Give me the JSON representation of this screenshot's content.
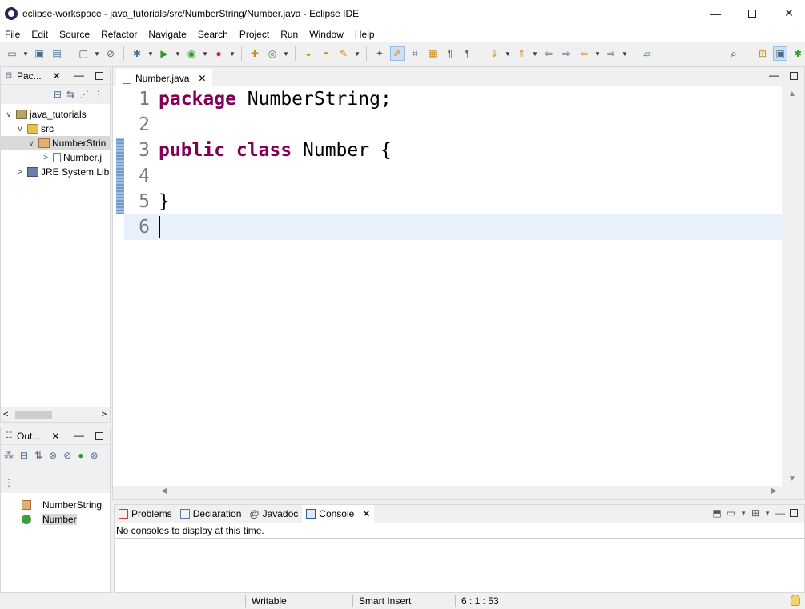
{
  "window": {
    "title": "eclipse-workspace - java_tutorials/src/NumberString/Number.java - Eclipse IDE",
    "minimize_glyph": "—",
    "close_glyph": "✕"
  },
  "menu": [
    "File",
    "Edit",
    "Source",
    "Refactor",
    "Navigate",
    "Search",
    "Project",
    "Run",
    "Window",
    "Help"
  ],
  "package_explorer": {
    "tab_label": "Pac...",
    "tree": [
      {
        "label": "java_tutorials",
        "arrow": "v",
        "icon": "project-icon"
      },
      {
        "label": "src",
        "arrow": "v",
        "icon": "source-folder-icon"
      },
      {
        "label": "NumberStrin",
        "arrow": "v",
        "icon": "package-icon"
      },
      {
        "label": "Number.j",
        "arrow": ">",
        "icon": "java-file-icon"
      },
      {
        "label": "JRE System Lib",
        "arrow": ">",
        "icon": "library-icon"
      }
    ],
    "scroll_left": "<",
    "scroll_right": ">"
  },
  "outline": {
    "tab_label": "Out...",
    "items": [
      {
        "label": "NumberString",
        "icon": "package-icon"
      },
      {
        "label": "Number",
        "icon": "class-icon"
      }
    ]
  },
  "editor": {
    "tab_label": "Number.java",
    "lines": [
      {
        "num": "1",
        "keyword": "package",
        "rest": " NumberString;"
      },
      {
        "num": "2",
        "keyword": "",
        "rest": ""
      },
      {
        "num": "3",
        "keyword": "public class",
        "rest": " Number {"
      },
      {
        "num": "4",
        "keyword": "",
        "rest": ""
      },
      {
        "num": "5",
        "keyword": "",
        "rest": "}"
      },
      {
        "num": "6",
        "keyword": "",
        "rest": ""
      }
    ],
    "current_line": 6
  },
  "bottom_panel": {
    "tabs": [
      "Problems",
      "Declaration",
      "Javadoc",
      "Console"
    ],
    "active_tab": "Console",
    "javadoc_glyph": "@",
    "message": "No consoles to display at this time."
  },
  "status": {
    "writable": "Writable",
    "insert_mode": "Smart Insert",
    "position": "6 : 1 : 53"
  }
}
